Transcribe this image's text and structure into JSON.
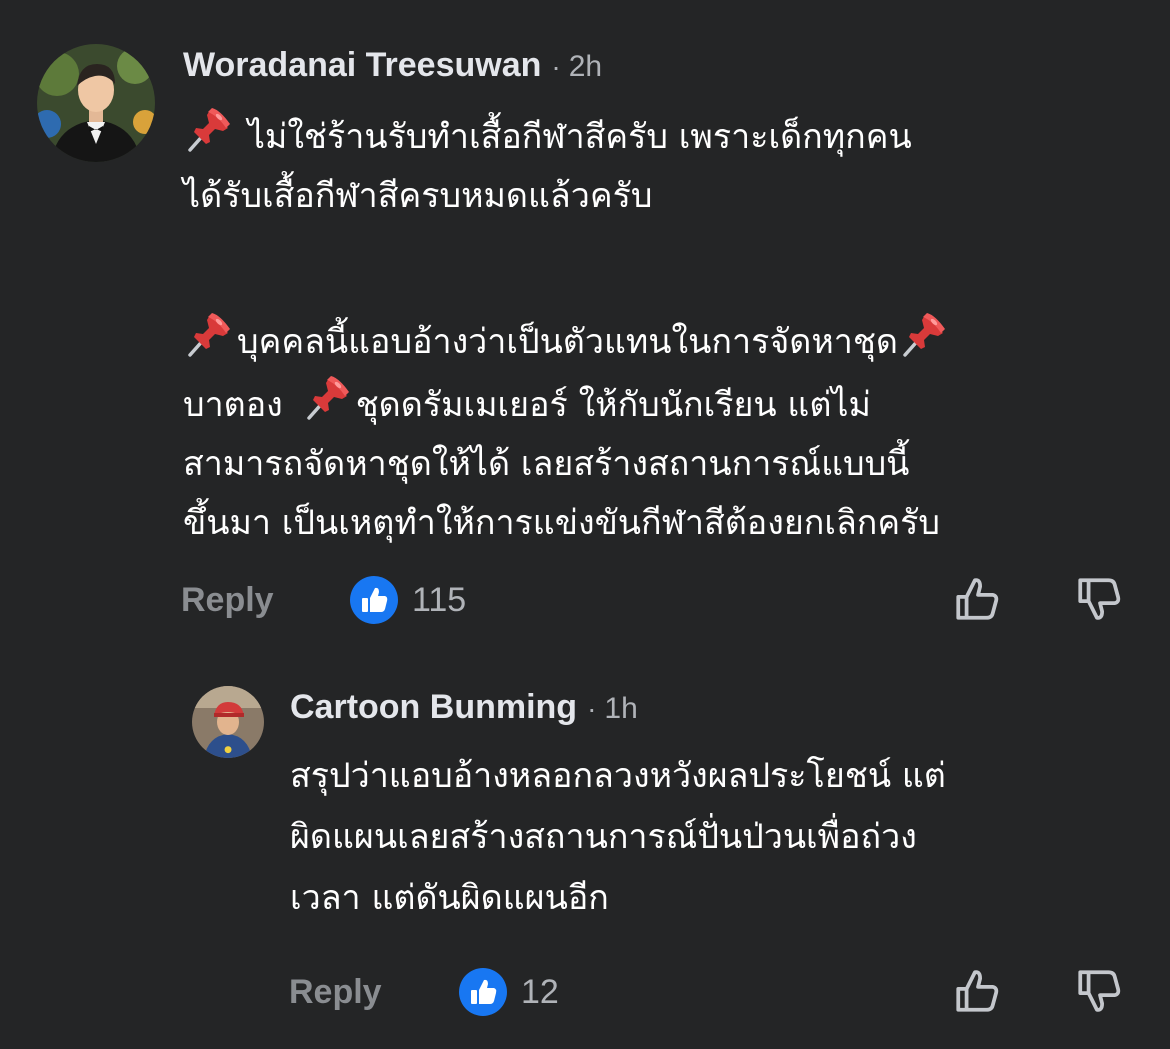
{
  "comments": [
    {
      "author": "Woradanai Treesuwan",
      "separator": "·",
      "time": "2h",
      "lines": {
        "l1": "ไม่ใช่ร้านรับทำเสื้อกีฬาสีครับ เพราะเด็กทุกคน",
        "l2": "ได้รับเสื้อกีฬาสีครบหมดแล้วครับ",
        "l3": "บุคคลนี้แอบอ้างว่าเป็นตัวแทนในการจัดหาชุด",
        "l4a": "บาตอง",
        "l4b": "ชุดดรัมเมเยอร์ ให้กับนักเรียน แต่ไม่",
        "l5": "สามารถจัดหาชุดให้ได้ เลยสร้างสถานการณ์แบบนี้",
        "l6": "ขึ้นมา เป็นเหตุทำให้การแข่งขันกีฬาสีต้องยกเลิกครับ"
      },
      "reply_label": "Reply",
      "like_count": "115",
      "like_icon": "like-badge-icon",
      "thumb_up_icon": "thumbs-up-outline-icon",
      "thumb_down_icon": "thumbs-down-outline-icon"
    },
    {
      "author": "Cartoon Bunming",
      "separator": "·",
      "time": "1h",
      "lines": {
        "l1": "สรุปว่าแอบอ้างหลอกลวงหวังผลประโยชน์ แต่",
        "l2": "ผิดแผนเลยสร้างสถานการณ์ปั่นป่วนเพื่อถ่วง",
        "l3": "เวลา แต่ดันผิดแผนอีก"
      },
      "reply_label": "Reply",
      "like_count": "12",
      "like_icon": "like-badge-icon",
      "thumb_up_icon": "thumbs-up-outline-icon",
      "thumb_down_icon": "thumbs-down-outline-icon"
    }
  ],
  "colors": {
    "background": "#242526",
    "text_primary": "#ffffff",
    "text_secondary": "#b0b3b8",
    "like_blue": "#1877f2",
    "pin_red": "#e0245e"
  }
}
